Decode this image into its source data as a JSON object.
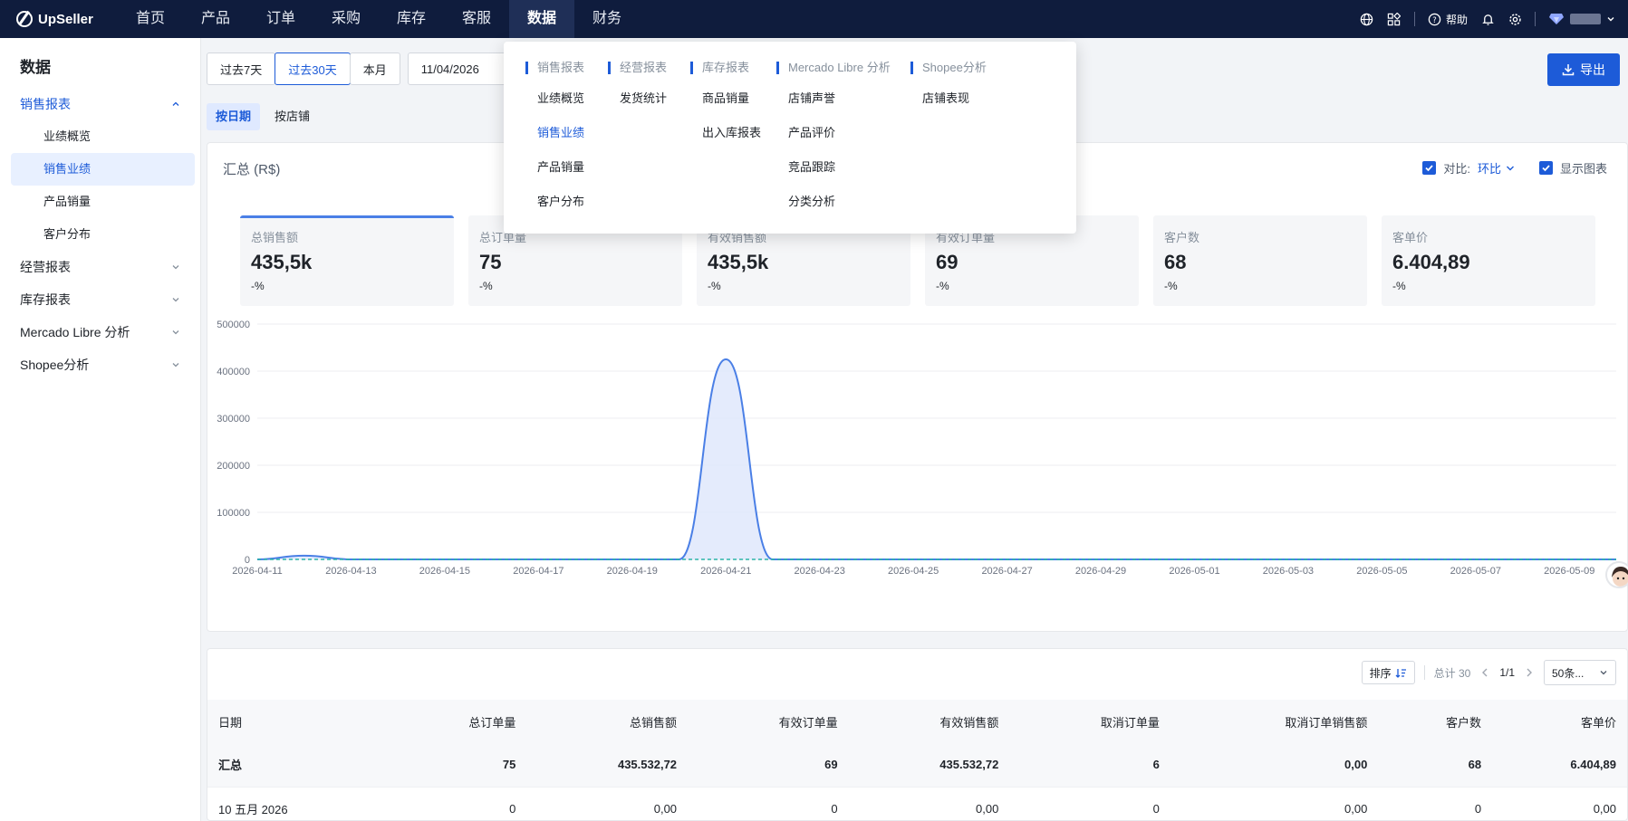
{
  "brand": {
    "name": "UpSeller"
  },
  "nav": {
    "items": [
      "首页",
      "产品",
      "订单",
      "采购",
      "库存",
      "客服",
      "数据",
      "财务"
    ],
    "active_index": 6,
    "help_label": "帮助",
    "icons": [
      "globe-icon",
      "apps-icon",
      "help-icon",
      "bell-icon",
      "gear-icon",
      "gem-icon",
      "chevron-down-icon"
    ]
  },
  "sidebar": {
    "title": "数据",
    "groups": [
      {
        "label": "销售报表",
        "open": true,
        "items": [
          "业绩概览",
          "销售业绩",
          "产品销量",
          "客户分布"
        ],
        "active_item": 1
      },
      {
        "label": "经营报表"
      },
      {
        "label": "库存报表"
      },
      {
        "label": "Mercado Libre 分析"
      },
      {
        "label": "Shopee分析"
      }
    ]
  },
  "filters": {
    "buttons": [
      "过去7天",
      "过去30天",
      "本月"
    ],
    "selected": 1,
    "date_value": "11/04/2026",
    "view_tabs": [
      "按日期",
      "按店铺"
    ],
    "export_label": "导出"
  },
  "summary": {
    "title": "汇总 (R$)",
    "compare_label": "对比:",
    "compare_value": "环比",
    "show_chart_label": "显示图表",
    "cards": [
      {
        "label": "总销售额",
        "value": "435,5k",
        "delta": "-%"
      },
      {
        "label": "总订单量",
        "value": "75",
        "delta": "-%"
      },
      {
        "label": "有效销售额",
        "value": "435,5k",
        "delta": "-%"
      },
      {
        "label": "有效订单量",
        "value": "69",
        "delta": "-%"
      },
      {
        "label": "客户数",
        "value": "68",
        "delta": "-%"
      },
      {
        "label": "客单价",
        "value": "6.404,89",
        "delta": "-%"
      }
    ]
  },
  "chart_data": {
    "type": "area",
    "title": "",
    "xlabel": "",
    "ylabel": "",
    "ylim": [
      0,
      500000
    ],
    "yticks": [
      "500000",
      "400000",
      "300000",
      "200000",
      "100000",
      "0"
    ],
    "xticks": [
      "2026-04-11",
      "2026-04-13",
      "2026-04-15",
      "2026-04-17",
      "2026-04-19",
      "2026-04-21",
      "2026-04-23",
      "2026-04-25",
      "2026-04-27",
      "2026-04-29",
      "2026-05-01",
      "2026-05-03",
      "2026-05-05",
      "2026-05-07",
      "2026-05-09"
    ],
    "series": [
      {
        "color": "#4a7fe6",
        "x": [
          "2026-04-11",
          "2026-04-12",
          "2026-04-13",
          "2026-04-14",
          "2026-04-15",
          "2026-04-16",
          "2026-04-17",
          "2026-04-18",
          "2026-04-19",
          "2026-04-20",
          "2026-04-21",
          "2026-04-22",
          "2026-04-23",
          "2026-04-24",
          "2026-04-25",
          "2026-04-26",
          "2026-04-27",
          "2026-04-28",
          "2026-04-29",
          "2026-04-30",
          "2026-05-01",
          "2026-05-02",
          "2026-05-03",
          "2026-05-04",
          "2026-05-05",
          "2026-05-06",
          "2026-05-07",
          "2026-05-08",
          "2026-05-09",
          "2026-05-10"
        ],
        "values": [
          0,
          8000,
          0,
          0,
          0,
          0,
          0,
          0,
          0,
          0,
          425000,
          0,
          0,
          0,
          0,
          0,
          0,
          0,
          0,
          0,
          0,
          0,
          0,
          0,
          0,
          0,
          0,
          0,
          0,
          0
        ]
      },
      {
        "color": "#2bb3a8",
        "dashed": true,
        "values": [
          0,
          0,
          0,
          0,
          0,
          0,
          0,
          0,
          0,
          0,
          0,
          0,
          0,
          0,
          0,
          0,
          0,
          0,
          0,
          0,
          0,
          0,
          0,
          0,
          0,
          0,
          0,
          0,
          0,
          0
        ]
      }
    ]
  },
  "table": {
    "sort_label": "排序",
    "total_label": "总计 30",
    "page": "1/1",
    "page_size": "50条...",
    "columns": [
      "日期",
      "总订单量",
      "总销售额",
      "有效订单量",
      "有效销售额",
      "取消订单量",
      "取消订单销售额",
      "客户数",
      "客单价"
    ],
    "rows": [
      [
        "汇总",
        "75",
        "435.532,72",
        "69",
        "435.532,72",
        "6",
        "0,00",
        "68",
        "6.404,89"
      ],
      [
        "10 五月 2026",
        "0",
        "0,00",
        "0",
        "0,00",
        "0",
        "0,00",
        "0",
        "0,00"
      ]
    ]
  },
  "dropdown": {
    "columns": [
      {
        "head": "销售报表",
        "items": [
          "业绩概览",
          "销售业绩",
          "产品销量",
          "客户分布"
        ],
        "active": 1
      },
      {
        "head": "经营报表",
        "items": [
          "发货统计"
        ]
      },
      {
        "head": "库存报表",
        "items": [
          "商品销量",
          "出入库报表"
        ]
      },
      {
        "head": "Mercado Libre 分析",
        "items": [
          "店铺声誉",
          "产品评价",
          "竞品跟踪",
          "分类分析"
        ]
      },
      {
        "head": "Shopee分析",
        "items": [
          "店铺表现"
        ]
      }
    ]
  }
}
